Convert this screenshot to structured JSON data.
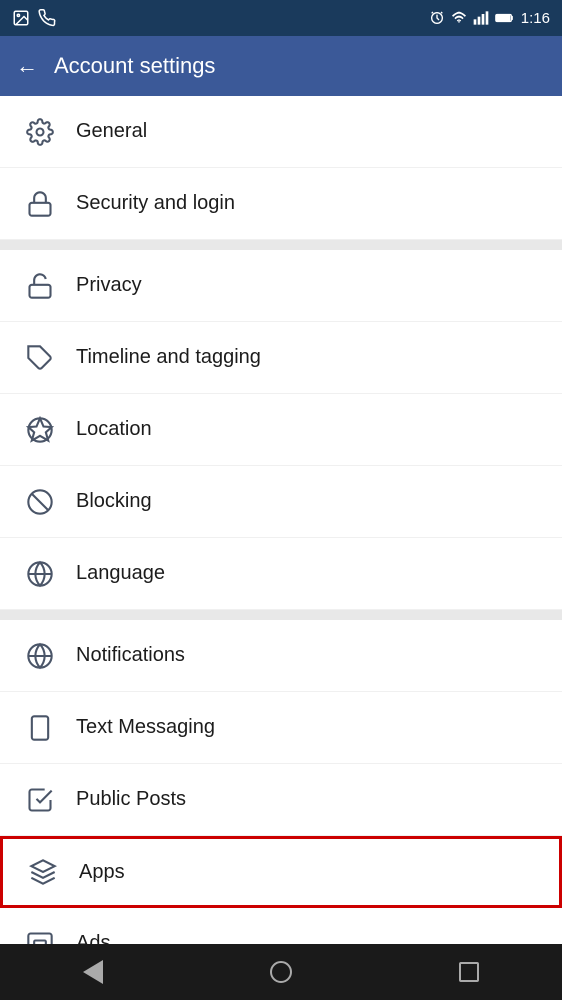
{
  "statusBar": {
    "time": "1:16",
    "icons": [
      "alarm",
      "wifi",
      "signal",
      "battery"
    ]
  },
  "header": {
    "backLabel": "←",
    "title": "Account settings"
  },
  "sections": [
    {
      "items": [
        {
          "id": "general",
          "label": "General",
          "icon": "gear"
        },
        {
          "id": "security",
          "label": "Security and login",
          "icon": "lock"
        }
      ]
    },
    {
      "items": [
        {
          "id": "privacy",
          "label": "Privacy",
          "icon": "lock-alt"
        },
        {
          "id": "timeline",
          "label": "Timeline and tagging",
          "icon": "tag"
        },
        {
          "id": "location",
          "label": "Location",
          "icon": "location"
        },
        {
          "id": "blocking",
          "label": "Blocking",
          "icon": "block"
        },
        {
          "id": "language",
          "label": "Language",
          "icon": "globe"
        }
      ]
    },
    {
      "items": [
        {
          "id": "notifications",
          "label": "Notifications",
          "icon": "globe-alt"
        },
        {
          "id": "text-messaging",
          "label": "Text Messaging",
          "icon": "phone"
        },
        {
          "id": "public-posts",
          "label": "Public Posts",
          "icon": "inbox-check"
        },
        {
          "id": "apps",
          "label": "Apps",
          "icon": "box",
          "highlighted": true
        },
        {
          "id": "ads",
          "label": "Ads",
          "icon": "dollar-box"
        }
      ]
    }
  ]
}
